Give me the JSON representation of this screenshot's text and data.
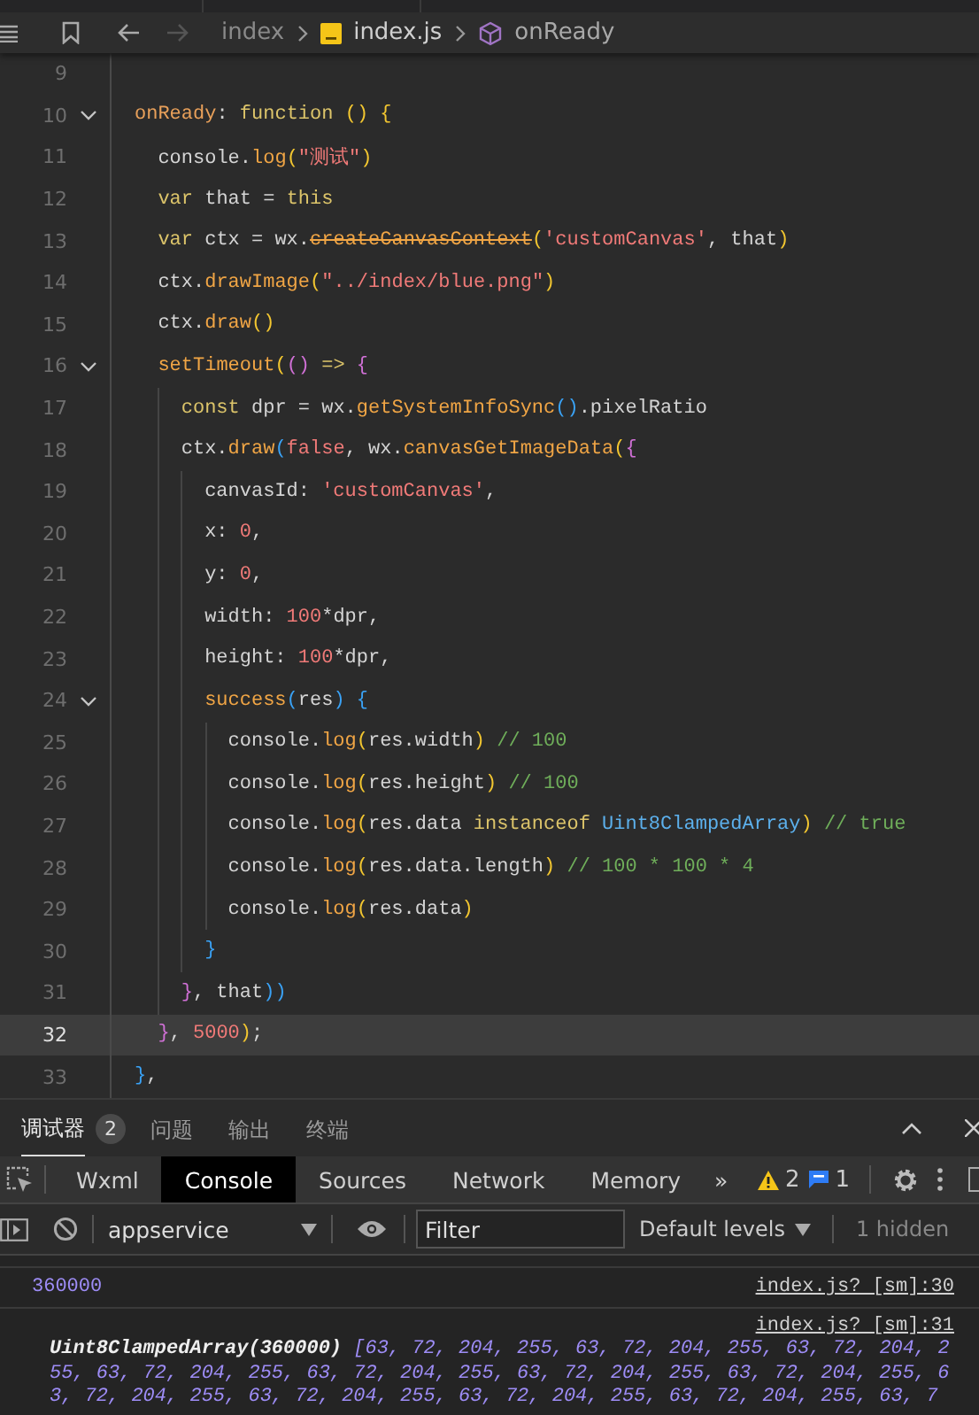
{
  "breadcrumb": [
    {
      "kind": "folder",
      "label": "index"
    },
    {
      "kind": "file",
      "label": "index.js"
    },
    {
      "kind": "symbol",
      "label": "onReady"
    }
  ],
  "editor": {
    "lines": [
      {
        "number": "9",
        "current": false
      },
      {
        "number": "10",
        "current": false,
        "folded": false,
        "tokens": [
          {
            "text": "onReady",
            "kind": "key"
          },
          {
            "text": ": ",
            "kind": "plain"
          },
          {
            "text": "function ",
            "kind": "keyword"
          },
          {
            "text": "()",
            "kind": "b1"
          },
          {
            "text": " {",
            "kind": "b1"
          }
        ]
      },
      {
        "number": "11",
        "current": false,
        "tokens": [
          {
            "text": "  console.",
            "kind": "plain"
          },
          {
            "text": "log",
            "kind": "func"
          },
          {
            "text": "(",
            "kind": "b1"
          },
          {
            "text": "\"测试\"",
            "kind": "string"
          },
          {
            "text": ")",
            "kind": "b1"
          }
        ]
      },
      {
        "number": "12",
        "current": false,
        "tokens": [
          {
            "text": "  var",
            "kind": "keyword"
          },
          {
            "text": " that = ",
            "kind": "plain"
          },
          {
            "text": "this",
            "kind": "keyword"
          }
        ]
      },
      {
        "number": "13",
        "current": false,
        "tokens": [
          {
            "text": "  var",
            "kind": "keyword"
          },
          {
            "text": " ctx = wx.",
            "kind": "plain"
          },
          {
            "text": "createCanvasContext",
            "kind": "deprecated"
          },
          {
            "text": "(",
            "kind": "b1"
          },
          {
            "text": "'customCanvas'",
            "kind": "string"
          },
          {
            "text": ", that",
            "kind": "plain"
          },
          {
            "text": ")",
            "kind": "b1"
          }
        ]
      },
      {
        "number": "14",
        "current": false,
        "tokens": [
          {
            "text": "  ctx.",
            "kind": "plain"
          },
          {
            "text": "drawImage",
            "kind": "func"
          },
          {
            "text": "(",
            "kind": "b1"
          },
          {
            "text": "\"../index/blue.png\"",
            "kind": "string"
          },
          {
            "text": ")",
            "kind": "b1"
          }
        ]
      },
      {
        "number": "15",
        "current": false,
        "tokens": [
          {
            "text": "  ctx.",
            "kind": "plain"
          },
          {
            "text": "draw",
            "kind": "func"
          },
          {
            "text": "()",
            "kind": "b1"
          }
        ]
      },
      {
        "number": "16",
        "current": false,
        "folded": false,
        "tokens": [
          {
            "text": "  setTimeout",
            "kind": "func"
          },
          {
            "text": "(",
            "kind": "b1"
          },
          {
            "text": "()",
            "kind": "b2"
          },
          {
            "text": " => ",
            "kind": "keyword"
          },
          {
            "text": "{",
            "kind": "b2"
          }
        ]
      },
      {
        "number": "17",
        "current": false,
        "tokens": [
          {
            "text": "    const",
            "kind": "keyword"
          },
          {
            "text": " dpr = wx.",
            "kind": "plain"
          },
          {
            "text": "getSystemInfoSync",
            "kind": "func"
          },
          {
            "text": "()",
            "kind": "b3"
          },
          {
            "text": ".pixelRatio",
            "kind": "plain"
          }
        ]
      },
      {
        "number": "18",
        "current": false,
        "tokens": [
          {
            "text": "    ctx.",
            "kind": "plain"
          },
          {
            "text": "draw",
            "kind": "func"
          },
          {
            "text": "(",
            "kind": "b3"
          },
          {
            "text": "false",
            "kind": "number"
          },
          {
            "text": ", wx.",
            "kind": "plain"
          },
          {
            "text": "canvasGetImageData",
            "kind": "func"
          },
          {
            "text": "(",
            "kind": "b1"
          },
          {
            "text": "{",
            "kind": "b2"
          }
        ]
      },
      {
        "number": "19",
        "current": false,
        "tokens": [
          {
            "text": "      canvasId: ",
            "kind": "plain"
          },
          {
            "text": "'customCanvas'",
            "kind": "string"
          },
          {
            "text": ",",
            "kind": "plain"
          }
        ]
      },
      {
        "number": "20",
        "current": false,
        "tokens": [
          {
            "text": "      x: ",
            "kind": "plain"
          },
          {
            "text": "0",
            "kind": "number"
          },
          {
            "text": ",",
            "kind": "plain"
          }
        ]
      },
      {
        "number": "21",
        "current": false,
        "tokens": [
          {
            "text": "      y: ",
            "kind": "plain"
          },
          {
            "text": "0",
            "kind": "number"
          },
          {
            "text": ",",
            "kind": "plain"
          }
        ]
      },
      {
        "number": "22",
        "current": false,
        "tokens": [
          {
            "text": "      width: ",
            "kind": "plain"
          },
          {
            "text": "100",
            "kind": "number"
          },
          {
            "text": "*dpr,",
            "kind": "plain"
          }
        ]
      },
      {
        "number": "23",
        "current": false,
        "tokens": [
          {
            "text": "      height: ",
            "kind": "plain"
          },
          {
            "text": "100",
            "kind": "number"
          },
          {
            "text": "*dpr,",
            "kind": "plain"
          }
        ]
      },
      {
        "number": "24",
        "current": false,
        "folded": false,
        "tokens": [
          {
            "text": "      success",
            "kind": "func"
          },
          {
            "text": "(",
            "kind": "b3"
          },
          {
            "text": "res",
            "kind": "plain"
          },
          {
            "text": ")",
            "kind": "b3"
          },
          {
            "text": " {",
            "kind": "b3"
          }
        ]
      },
      {
        "number": "25",
        "current": false,
        "tokens": [
          {
            "text": "        console.",
            "kind": "plain"
          },
          {
            "text": "log",
            "kind": "func"
          },
          {
            "text": "(",
            "kind": "b1"
          },
          {
            "text": "res.width",
            "kind": "plain"
          },
          {
            "text": ")",
            "kind": "b1"
          },
          {
            "text": " // 100",
            "kind": "comment"
          }
        ]
      },
      {
        "number": "26",
        "current": false,
        "tokens": [
          {
            "text": "        console.",
            "kind": "plain"
          },
          {
            "text": "log",
            "kind": "func"
          },
          {
            "text": "(",
            "kind": "b1"
          },
          {
            "text": "res.height",
            "kind": "plain"
          },
          {
            "text": ")",
            "kind": "b1"
          },
          {
            "text": " // 100",
            "kind": "comment"
          }
        ]
      },
      {
        "number": "27",
        "current": false,
        "tokens": [
          {
            "text": "        console.",
            "kind": "plain"
          },
          {
            "text": "log",
            "kind": "func"
          },
          {
            "text": "(",
            "kind": "b1"
          },
          {
            "text": "res.data ",
            "kind": "plain"
          },
          {
            "text": "instanceof ",
            "kind": "keyword"
          },
          {
            "text": "Uint8ClampedArray",
            "kind": "type"
          },
          {
            "text": ")",
            "kind": "b1"
          },
          {
            "text": " // true",
            "kind": "comment"
          }
        ]
      },
      {
        "number": "28",
        "current": false,
        "tokens": [
          {
            "text": "        console.",
            "kind": "plain"
          },
          {
            "text": "log",
            "kind": "func"
          },
          {
            "text": "(",
            "kind": "b1"
          },
          {
            "text": "res.data.length",
            "kind": "plain"
          },
          {
            "text": ")",
            "kind": "b1"
          },
          {
            "text": " // 100 * 100 * 4",
            "kind": "comment"
          }
        ]
      },
      {
        "number": "29",
        "current": false,
        "tokens": [
          {
            "text": "        console.",
            "kind": "plain"
          },
          {
            "text": "log",
            "kind": "func"
          },
          {
            "text": "(",
            "kind": "b1"
          },
          {
            "text": "res.data",
            "kind": "plain"
          },
          {
            "text": ")",
            "kind": "b1"
          }
        ]
      },
      {
        "number": "30",
        "current": false,
        "tokens": [
          {
            "text": "      }",
            "kind": "b3"
          }
        ]
      },
      {
        "number": "31",
        "current": false,
        "tokens": [
          {
            "text": "    }",
            "kind": "b2"
          },
          {
            "text": ", that",
            "kind": "plain"
          },
          {
            "text": "))",
            "kind": "b3"
          }
        ]
      },
      {
        "number": "32",
        "current": true,
        "tokens": [
          {
            "text": "  }",
            "kind": "b2"
          },
          {
            "text": ", ",
            "kind": "plain"
          },
          {
            "text": "5000",
            "kind": "number"
          },
          {
            "text": ")",
            "kind": "b1"
          },
          {
            "text": ";",
            "kind": "plain"
          }
        ]
      },
      {
        "number": "33",
        "current": false,
        "tokens": [
          {
            "text": "}",
            "kind": "b3"
          },
          {
            "text": ",",
            "kind": "plain"
          }
        ]
      }
    ]
  },
  "panel": {
    "tabs": [
      {
        "label": "调试器",
        "badge": "2",
        "selected": true
      },
      {
        "label": "问题",
        "selected": false
      },
      {
        "label": "输出",
        "selected": false
      },
      {
        "label": "终端",
        "selected": false
      }
    ],
    "devtools_tabs": [
      {
        "label": "Wxml",
        "selected": false
      },
      {
        "label": "Console",
        "selected": true
      },
      {
        "label": "Sources",
        "selected": false
      },
      {
        "label": "Network",
        "selected": false
      },
      {
        "label": "Memory",
        "selected": false
      }
    ],
    "more": "»",
    "warnings": "2",
    "messages": "1",
    "toolbar": {
      "context": "appservice",
      "filter_placeholder": "Filter",
      "levels": "Default levels",
      "hidden": "1 hidden"
    },
    "console": [
      {
        "kind": "number",
        "text": "360000",
        "source": "index.js? [sm]:30"
      },
      {
        "kind": "array",
        "label": "Uint8ClampedArray(360000)",
        "lines": [
          "[63, 72, 204, 255, 63, 72, 204, 255, 63, 72, 204, 2",
          "55, 63, 72, 204, 255, 63, 72, 204, 255, 63, 72, 204, 255, 63, 72, 204, 255, 6",
          "3, 72, 204, 255, 63, 72, 204, 255, 63, 72, 204, 255, 63, 72, 204, 255, 63, 7"
        ],
        "source": "index.js? [sm]:31"
      }
    ]
  }
}
